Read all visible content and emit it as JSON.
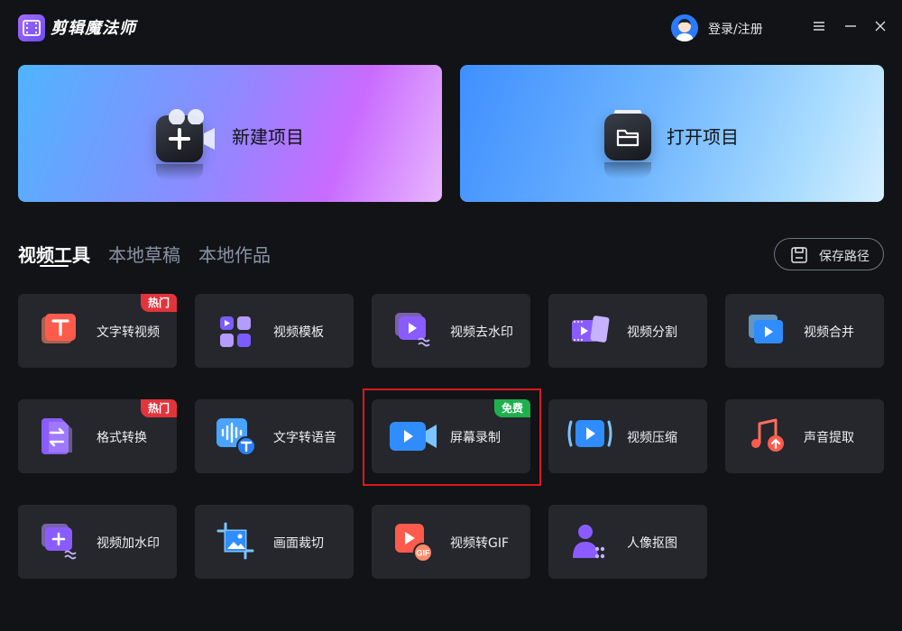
{
  "app": {
    "name": "剪辑魔法师",
    "login_label": "登录/注册"
  },
  "cards": {
    "new_project": "新建项目",
    "open_project": "打开项目"
  },
  "tabs": [
    "视频工具",
    "本地草稿",
    "本地作品"
  ],
  "save_path_label": "保存路径",
  "tools": [
    {
      "label": "文字转视频",
      "badge": "热门",
      "icon": "text-to-video-icon"
    },
    {
      "label": "视频模板",
      "badge": "",
      "icon": "video-template-icon"
    },
    {
      "label": "视频去水印",
      "badge": "",
      "icon": "remove-watermark-icon"
    },
    {
      "label": "视频分割",
      "badge": "",
      "icon": "video-split-icon"
    },
    {
      "label": "视频合并",
      "badge": "",
      "icon": "video-merge-icon"
    },
    {
      "label": "格式转换",
      "badge": "热门",
      "icon": "format-convert-icon"
    },
    {
      "label": "文字转语音",
      "badge": "",
      "icon": "text-to-speech-icon"
    },
    {
      "label": "屏幕录制",
      "badge": "免费",
      "icon": "screen-record-icon"
    },
    {
      "label": "视频压缩",
      "badge": "",
      "icon": "video-compress-icon"
    },
    {
      "label": "声音提取",
      "badge": "",
      "icon": "audio-extract-icon"
    },
    {
      "label": "视频加水印",
      "badge": "",
      "icon": "add-watermark-icon"
    },
    {
      "label": "画面裁切",
      "badge": "",
      "icon": "crop-icon"
    },
    {
      "label": "视频转GIF",
      "badge": "",
      "icon": "video-to-gif-icon"
    },
    {
      "label": "人像抠图",
      "badge": "",
      "icon": "portrait-cutout-icon"
    }
  ],
  "colors": {
    "accent_hot": "#e2343c",
    "accent_free": "#1fb04e",
    "highlight": "#d8191d"
  }
}
